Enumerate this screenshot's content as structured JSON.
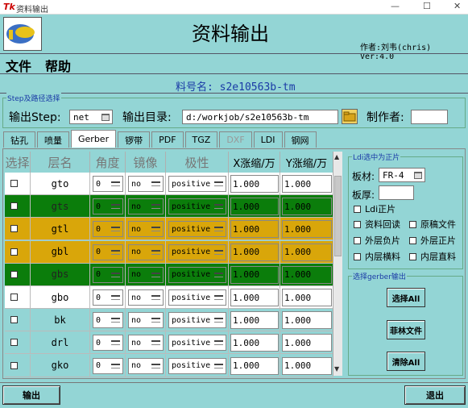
{
  "window": {
    "title": "资料输出",
    "app_icon": "Tk",
    "minimize": "—",
    "maximize": "☐",
    "close": "✕"
  },
  "header": {
    "title": "资料输出",
    "author": "作者:刘韦(chris)  Ver:4.0"
  },
  "menu": {
    "file": "文件",
    "help": "帮助"
  },
  "part_number": "料号名: s2e10563b-tm",
  "step_frame": {
    "legend": "Step及路径选择",
    "output_step_label": "输出Step:",
    "output_step_value": "net",
    "output_dir_label": "输出目录:",
    "output_dir_value": "d:/workjob/s2e10563b-tm",
    "maker_label": "制作者:",
    "maker_value": ""
  },
  "tabs": [
    {
      "label": "钻孔",
      "selected": false,
      "disabled": false
    },
    {
      "label": "喷量",
      "selected": false,
      "disabled": false
    },
    {
      "label": "Gerber",
      "selected": true,
      "disabled": false
    },
    {
      "label": "锣带",
      "selected": false,
      "disabled": false
    },
    {
      "label": "PDF",
      "selected": false,
      "disabled": false
    },
    {
      "label": "TGZ",
      "selected": false,
      "disabled": false
    },
    {
      "label": "DXF",
      "selected": false,
      "disabled": true
    },
    {
      "label": "LDI",
      "selected": false,
      "disabled": false
    },
    {
      "label": "钢网",
      "selected": false,
      "disabled": false
    }
  ],
  "grid": {
    "headers": [
      "选择",
      "层名",
      "角度",
      "镜像",
      "极性",
      "X涨缩/万",
      "Y涨缩/万"
    ],
    "rows": [
      {
        "name": "gto",
        "angle": "0",
        "mirror": "no",
        "polarity": "positive",
        "x": "1.000",
        "y": "1.000",
        "color": "#ffffff"
      },
      {
        "name": "gts",
        "angle": "0",
        "mirror": "no",
        "polarity": "positive",
        "x": "1.000",
        "y": "1.000",
        "color": "#0b7d0b"
      },
      {
        "name": "gtl",
        "angle": "0",
        "mirror": "no",
        "polarity": "positive",
        "x": "1.000",
        "y": "1.000",
        "color": "#d9a60a"
      },
      {
        "name": "gbl",
        "angle": "0",
        "mirror": "no",
        "polarity": "positive",
        "x": "1.000",
        "y": "1.000",
        "color": "#d9a60a"
      },
      {
        "name": "gbs",
        "angle": "0",
        "mirror": "no",
        "polarity": "positive",
        "x": "1.000",
        "y": "1.000",
        "color": "#0b7d0b"
      },
      {
        "name": "gbo",
        "angle": "0",
        "mirror": "no",
        "polarity": "positive",
        "x": "1.000",
        "y": "1.000",
        "color": "#ffffff"
      },
      {
        "name": "bk",
        "angle": "0",
        "mirror": "no",
        "polarity": "positive",
        "x": "1.000",
        "y": "1.000",
        "color": "#93d5d5"
      },
      {
        "name": "drl",
        "angle": "0",
        "mirror": "no",
        "polarity": "positive",
        "x": "1.000",
        "y": "1.000",
        "color": "#93d5d5"
      },
      {
        "name": "gko",
        "angle": "0",
        "mirror": "no",
        "polarity": "positive",
        "x": "1.000",
        "y": "1.000",
        "color": "#93d5d5"
      }
    ]
  },
  "ldi_frame": {
    "legend": "Ldi选中为正片",
    "material_label": "板材:",
    "material_value": "FR-4",
    "thickness_label": "板厚:",
    "thickness_value": "",
    "options": [
      "Ldi正片",
      "资料回读",
      "原稿文件",
      "外层负片",
      "外层正片",
      "内层横料",
      "内层直料"
    ]
  },
  "gerber_frame": {
    "legend": "选择gerber输出",
    "select_all": "选择All",
    "film_file": "菲林文件",
    "clear_all": "清除All"
  },
  "bottom": {
    "output": "输出",
    "exit": "退出"
  },
  "colors": {
    "background": "#93d5d5",
    "green_row": "#0b7d0b",
    "gold_row": "#d9a60a",
    "accent_text": "#1a3aa6"
  }
}
